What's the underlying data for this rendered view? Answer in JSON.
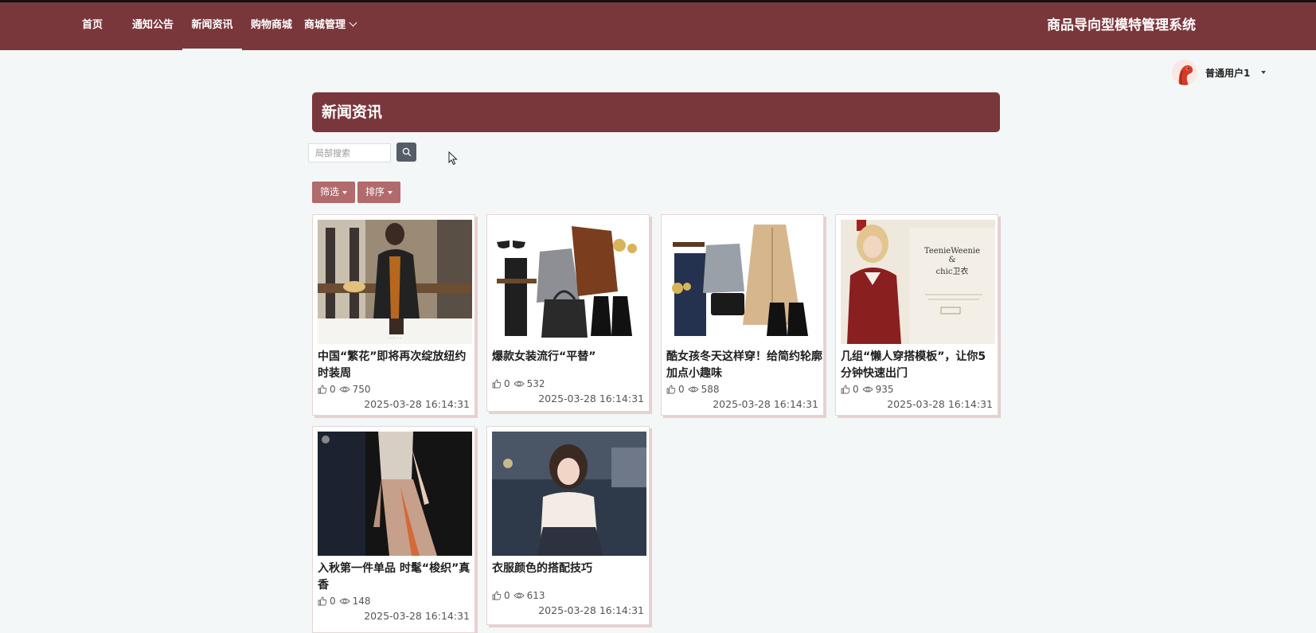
{
  "nav": {
    "items": [
      {
        "label": "首页"
      },
      {
        "label": "通知公告"
      },
      {
        "label": "新闻资讯",
        "active": true
      },
      {
        "label": "购物商城"
      },
      {
        "label": "商城管理"
      }
    ],
    "brand": "商品导向型模特管理系统"
  },
  "user": {
    "name": "普通用户1"
  },
  "page": {
    "title": "新闻资讯"
  },
  "search": {
    "placeholder": "局部搜索"
  },
  "filters": {
    "filter_label": "筛选",
    "sort_label": "排序"
  },
  "colors": {
    "primary": "#7a373b",
    "button": "#b26a6c",
    "background": "#f3f7f7"
  },
  "news": [
    {
      "title": "中国“繁花”即将再次绽放纽约时装周",
      "likes": "0",
      "views": "750",
      "date": "2025-03-28 16:14:31"
    },
    {
      "title": "爆款女装流行“平替”",
      "likes": "0",
      "views": "532",
      "date": "2025-03-28 16:14:31"
    },
    {
      "title": "酷女孩冬天这样穿！给简约轮廓加点小趣味",
      "likes": "0",
      "views": "588",
      "date": "2025-03-28 16:14:31"
    },
    {
      "title": "几组“懒人穿搭模板”，让你5分钟快速出门",
      "likes": "0",
      "views": "935",
      "date": "2025-03-28 16:14:31"
    },
    {
      "title": "入秋第一件单品 时髦“梭织”真香",
      "likes": "0",
      "views": "148",
      "date": "2025-03-28 16:14:31"
    },
    {
      "title": "衣服颜色的搭配技巧",
      "likes": "0",
      "views": "613",
      "date": "2025-03-28 16:14:31"
    }
  ]
}
